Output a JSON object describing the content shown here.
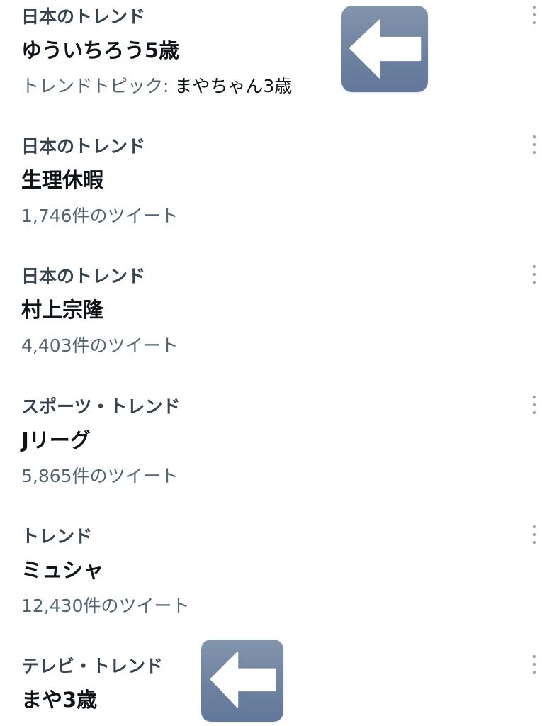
{
  "trends": [
    {
      "context": "日本のトレンド",
      "topic": "ゆういちろう5歳",
      "meta_prefix": "トレンドトピック: ",
      "meta_topic": "まやちゃん3歳"
    },
    {
      "context": "日本のトレンド",
      "topic": "生理休暇",
      "meta": "1,746件のツイート"
    },
    {
      "context": "日本のトレンド",
      "topic": "村上宗隆",
      "meta": "4,403件のツイート"
    },
    {
      "context": "スポーツ・トレンド",
      "topic": "Jリーグ",
      "meta": "5,865件のツイート"
    },
    {
      "context": "トレンド",
      "topic": "ミュシャ",
      "meta": "12,430件のツイート"
    },
    {
      "context": "テレビ・トレンド",
      "topic": "まや3歳"
    }
  ],
  "icons": {
    "more": "more-vertical-icon",
    "overlay_arrow": "left-arrow-icon"
  },
  "colors": {
    "context_text": "#37434e",
    "topic_text": "#0f1419",
    "meta_text": "#536471",
    "overlay_arrow_bg": "#6f82a0",
    "overlay_arrow_fg": "#ffffff"
  }
}
